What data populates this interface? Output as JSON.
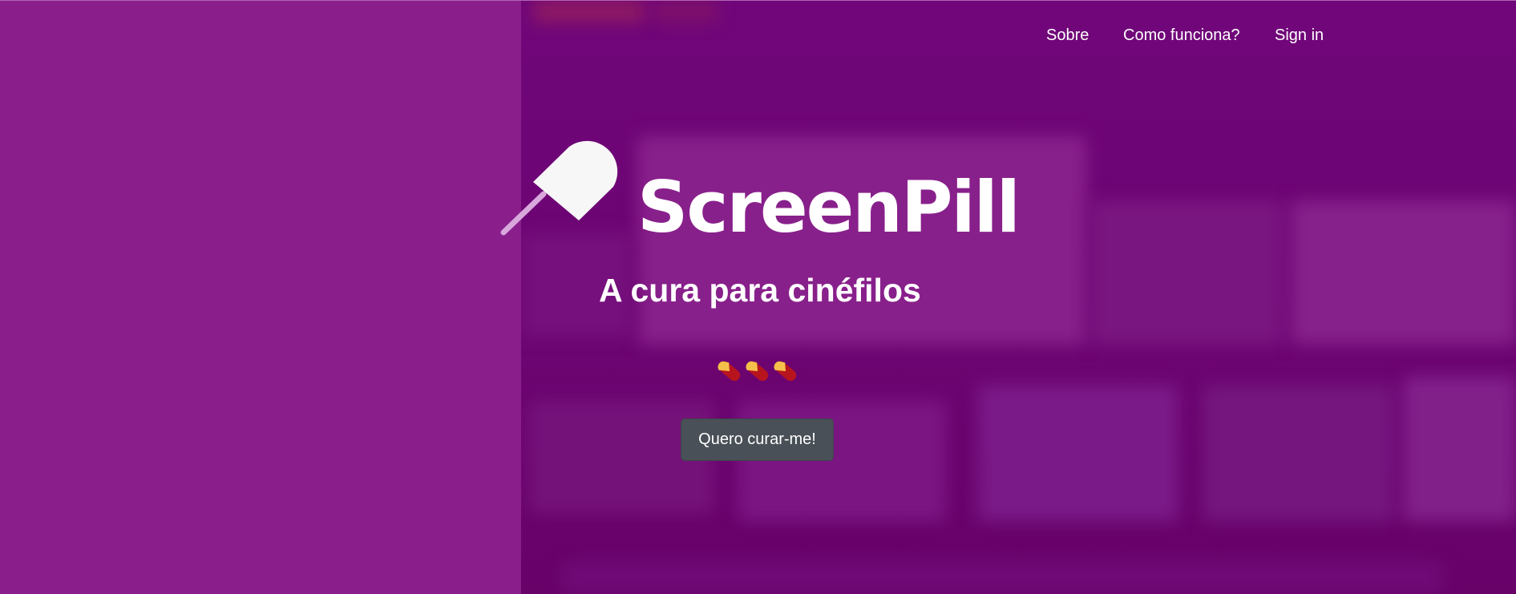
{
  "nav": {
    "about": "Sobre",
    "how_it_works": "Como funciona?",
    "sign_in": "Sign in"
  },
  "hero": {
    "logo_text": "ScreenPill",
    "tagline": "A cura para cinéfilos",
    "pill_icons": [
      "pill-icon",
      "pill-icon",
      "pill-icon"
    ],
    "cta_label": "Quero curar-me!"
  },
  "colors": {
    "left_panel": "#8a1f8c",
    "right_panel": "#6a0670",
    "button": "#495057",
    "text": "#ffffff",
    "pill_yellow": "#f5c04a",
    "pill_red": "#b8141e"
  }
}
